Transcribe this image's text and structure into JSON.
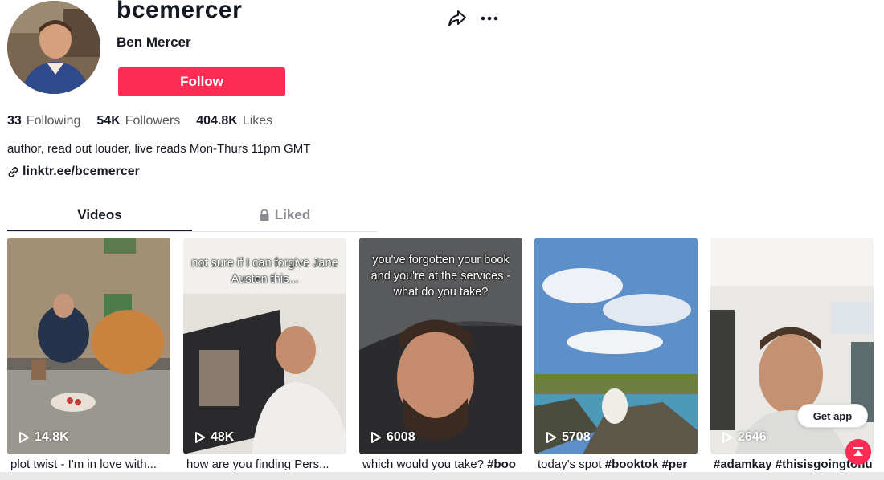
{
  "profile": {
    "username": "bcemercer",
    "display_name": "Ben Mercer",
    "follow_label": "Follow",
    "bio": "author, read out louder, live reads Mon-Thurs 11pm GMT",
    "link": "linktr.ee/bcemercer"
  },
  "stats": [
    {
      "value": "33",
      "label": "Following"
    },
    {
      "value": "54K",
      "label": "Followers"
    },
    {
      "value": "404.8K",
      "label": "Likes"
    }
  ],
  "tabs": [
    {
      "label": "Videos",
      "active": true
    },
    {
      "label": "Liked",
      "active": false,
      "icon": "lock-icon"
    }
  ],
  "videos": [
    {
      "views": "14.8K",
      "overlay": "",
      "caption": "plot twist - I'm in love with...",
      "hashtag": ""
    },
    {
      "views": "48K",
      "overlay": "not sure if I can forgive Jane Austen this...",
      "caption": "how are you finding Pers...",
      "hashtag": ""
    },
    {
      "views": "6008",
      "overlay": "you've forgotten your book and you're at the services - what do you take?",
      "caption": "which would you take? ",
      "hashtag": "#boo"
    },
    {
      "views": "5708",
      "overlay": "",
      "caption": "today's spot ",
      "hashtag": "#booktok #per"
    },
    {
      "views": "2646",
      "overlay": "",
      "caption": "",
      "hashtag": "#adamkay #thisisgoingtohu"
    }
  ],
  "get_app_label": "Get app",
  "icons": {
    "share": "share-icon",
    "more": "more-icon",
    "link": "link-icon",
    "play": "play-icon",
    "back_to_top": "back-to-top-icon"
  },
  "colors": {
    "accent": "#fe2c55",
    "text": "#161823",
    "muted": "#57585e"
  }
}
